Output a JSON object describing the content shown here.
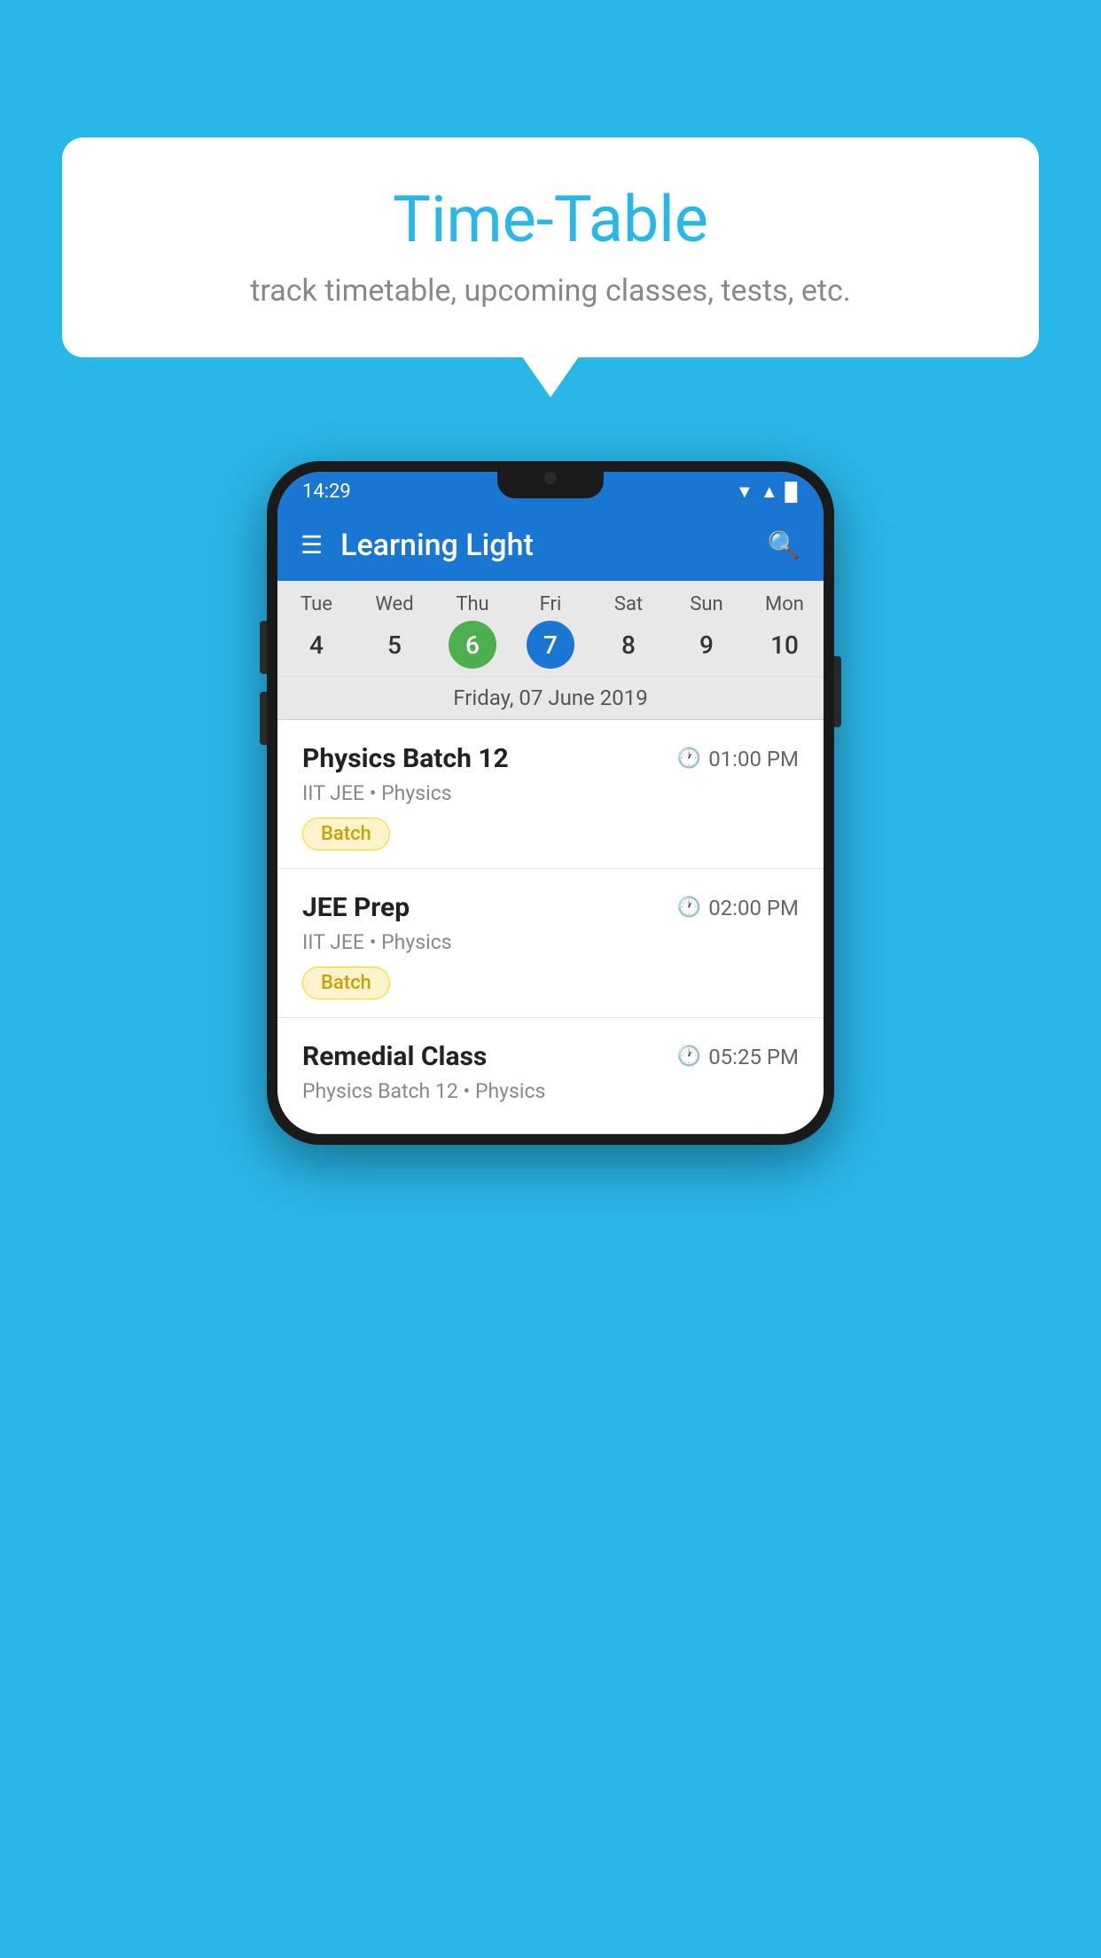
{
  "background_color": "#29B6E8",
  "bubble": {
    "title": "Time-Table",
    "subtitle": "track timetable, upcoming classes, tests, etc."
  },
  "phone": {
    "status_bar": {
      "time": "14:29",
      "wifi": "▼",
      "signal": "▲",
      "battery": "▉"
    },
    "app_bar": {
      "title": "Learning Light"
    },
    "calendar": {
      "days": [
        {
          "name": "Tue",
          "num": "4",
          "state": "normal"
        },
        {
          "name": "Wed",
          "num": "5",
          "state": "normal"
        },
        {
          "name": "Thu",
          "num": "6",
          "state": "today"
        },
        {
          "name": "Fri",
          "num": "7",
          "state": "selected"
        },
        {
          "name": "Sat",
          "num": "8",
          "state": "normal"
        },
        {
          "name": "Sun",
          "num": "9",
          "state": "normal"
        },
        {
          "name": "Mon",
          "num": "10",
          "state": "normal"
        }
      ],
      "selected_date_label": "Friday, 07 June 2019"
    },
    "classes": [
      {
        "name": "Physics Batch 12",
        "time": "01:00 PM",
        "meta": "IIT JEE • Physics",
        "badge": "Batch"
      },
      {
        "name": "JEE Prep",
        "time": "02:00 PM",
        "meta": "IIT JEE • Physics",
        "badge": "Batch"
      },
      {
        "name": "Remedial Class",
        "time": "05:25 PM",
        "meta": "Physics Batch 12 • Physics",
        "badge": ""
      }
    ]
  }
}
